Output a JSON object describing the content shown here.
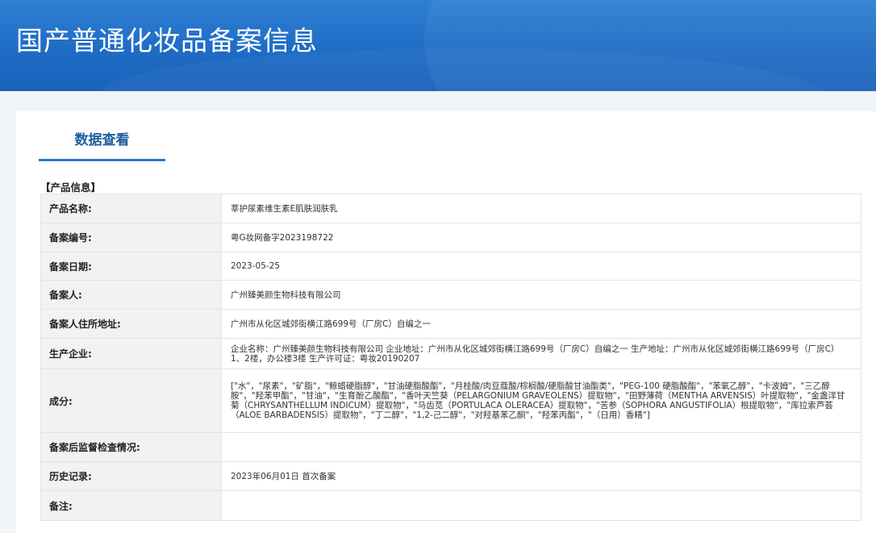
{
  "header": {
    "title": "国产普通化妆品备案信息"
  },
  "tabs": [
    {
      "label": "数据查看",
      "active": true
    }
  ],
  "section_title": "【产品信息】",
  "rows": [
    {
      "label": "产品名称:",
      "value": "莘护尿素维生素E肌肤润肤乳"
    },
    {
      "label": "备案编号:",
      "value": "粤G妆网备字2023198722"
    },
    {
      "label": "备案日期:",
      "value": "2023-05-25"
    },
    {
      "label": "备案人:",
      "value": "广州臻美颜生物科技有限公司"
    },
    {
      "label": "备案人住所地址:",
      "value": "广州市从化区城郊街横江路699号（厂房C）自编之一"
    },
    {
      "label": "生产企业:",
      "value": "企业名称：广州臻美颜生物科技有限公司 企业地址：广州市从化区城郊街横江路699号（厂房C）自编之一 生产地址：广州市从化区城郊街横江路699号（厂房C）1、2楼，办公楼3楼 生产许可证：粤妆20190207"
    },
    {
      "label": "成分:",
      "value": "[\"水\"，\"尿素\"，\"矿脂\"，\"鲸蜡硬脂醇\"，\"甘油硬脂酸酯\"，\"月桂酸/肉豆蔻酸/棕榈酸/硬脂酸甘油酯类\"，\"PEG-100 硬脂酸酯\"，\"苯氧乙醇\"，\"卡波姆\"，\"三乙醇胺\"，\"羟苯甲酯\"，\"甘油\"，\"生育酚乙酸酯\"，\"香叶天竺葵（PELARGONIUM GRAVEOLENS）提取物\"，\"田野薄荷（MENTHA ARVENSIS）叶提取物\"，\"金盏洋甘菊（CHRYSANTHELLUM INDICUM）提取物\"，\"马齿苋（PORTULACA OLERACEA）提取物\"，\"苦参（SOPHORA ANGUSTIFOLIA）根提取物\"，\"库拉索芦荟（ALOE BARBADENSIS）提取物\"，\"丁二醇\"，\"1,2-己二醇\"，\"对羟基苯乙酮\"，\"羟苯丙酯\"，\"（日用）香精\"]"
    },
    {
      "label": "备案后监督检查情况:",
      "value": ""
    },
    {
      "label": "历史记录:",
      "value": "2023年06月01日 首次备案"
    },
    {
      "label": "备注:",
      "value": ""
    }
  ],
  "colors": {
    "banner": "#1f6cc5",
    "tab_accent": "#2a78c8",
    "tab_text": "#1f5f9e",
    "label_bg": "#f2f2f2"
  }
}
